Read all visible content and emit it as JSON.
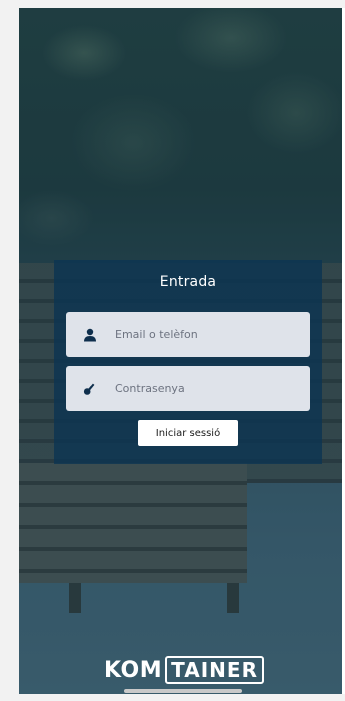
{
  "login": {
    "title": "Entrada",
    "email_placeholder": "Email o telèfon",
    "password_placeholder": "Contrasenya",
    "submit_label": "Iniciar sessió"
  },
  "logo": {
    "part1": "KOM",
    "part2": "TAINER"
  },
  "icons": {
    "email": "user-icon",
    "password": "key-icon"
  },
  "colors": {
    "card_bg": "#0c3452",
    "field_bg": "#dfe3ea",
    "button_bg": "#ffffff"
  }
}
